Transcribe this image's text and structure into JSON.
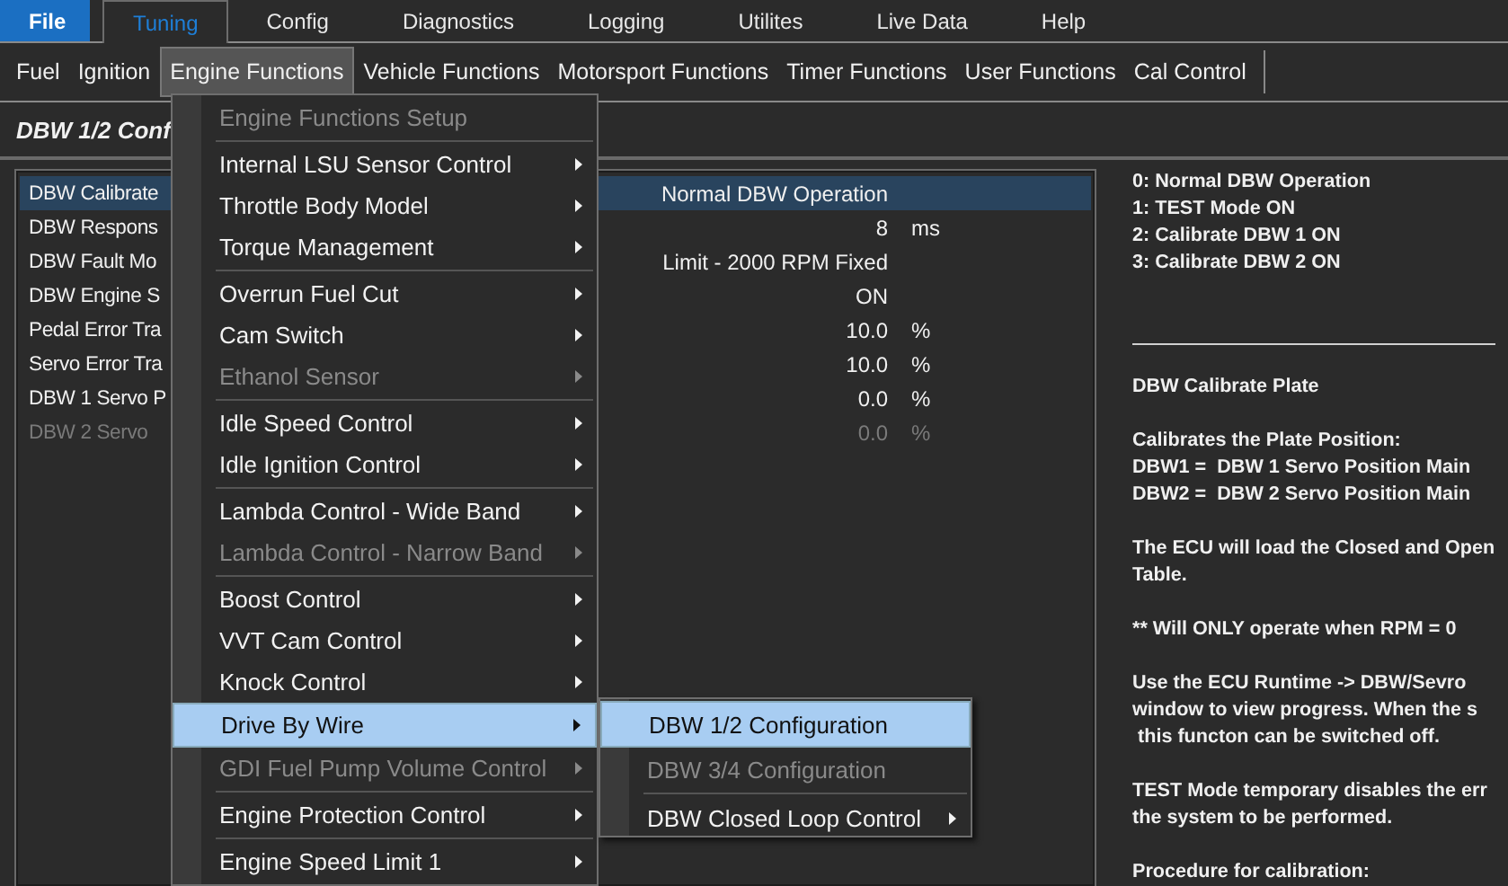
{
  "menubar": [
    {
      "label": "File",
      "kind": "file",
      "selected": false
    },
    {
      "label": "Tuning",
      "kind": "tab",
      "selected": true
    },
    {
      "label": "Config",
      "kind": "tab",
      "selected": false
    },
    {
      "label": "Diagnostics",
      "kind": "tab",
      "selected": false
    },
    {
      "label": "Logging",
      "kind": "tab",
      "selected": false
    },
    {
      "label": "Utilites",
      "kind": "tab",
      "selected": false
    },
    {
      "label": "Live Data",
      "kind": "tab",
      "selected": false
    },
    {
      "label": "Help",
      "kind": "tab",
      "selected": false
    }
  ],
  "toolbar": [
    {
      "label": "Fuel",
      "selected": false
    },
    {
      "label": "Ignition",
      "selected": false
    },
    {
      "label": "Engine Functions",
      "selected": true
    },
    {
      "label": "Vehicle Functions",
      "selected": false
    },
    {
      "label": "Motorsport Functions",
      "selected": false
    },
    {
      "label": "Timer Functions",
      "selected": false
    },
    {
      "label": "User Functions",
      "selected": false
    },
    {
      "label": "Cal Control",
      "selected": false
    }
  ],
  "page_title": "DBW 1/2 Conf",
  "settings": [
    {
      "name": "DBW Calibrate",
      "value": "Normal DBW Operation",
      "selected": true,
      "disabled": false
    },
    {
      "name": "DBW Respons",
      "value": "8",
      "unit": "ms",
      "selected": false,
      "disabled": false
    },
    {
      "name": "DBW Fault Mo",
      "value": "Limit - 2000 RPM Fixed",
      "selected": false,
      "disabled": false
    },
    {
      "name": "DBW Engine S",
      "value": "ON",
      "selected": false,
      "disabled": false
    },
    {
      "name": "Pedal Error Tra",
      "value": "10.0",
      "unit": "%",
      "selected": false,
      "disabled": false
    },
    {
      "name": "Servo Error Tra",
      "value": "10.0",
      "unit": "%",
      "selected": false,
      "disabled": false
    },
    {
      "name": "DBW 1 Servo P",
      "value": "0.0",
      "unit": "%",
      "selected": false,
      "disabled": false
    },
    {
      "name": "DBW 2 Servo",
      "value": "0.0",
      "unit": "%",
      "selected": false,
      "disabled": true
    }
  ],
  "help": {
    "options": [
      "0: Normal DBW Operation",
      "1: TEST Mode ON",
      "2: Calibrate DBW 1 ON",
      "3: Calibrate DBW 2 ON"
    ],
    "paragraphs": [
      [
        "DBW Calibrate Plate"
      ],
      [
        "Calibrates the Plate Position:",
        "DBW1 =  DBW 1 Servo Position Main",
        "DBW2 =  DBW 2 Servo Position Main"
      ],
      [
        "The ECU will load the Closed and Open",
        "Table."
      ],
      [
        "** Will ONLY operate when RPM = 0"
      ],
      [
        "Use the ECU Runtime -> DBW/Sevro",
        "window to view progress. When the s",
        " this functon can be switched off."
      ],
      [
        "TEST Mode temporary disables the err",
        "the system to be performed."
      ],
      [
        "Procedure for calibration:"
      ]
    ]
  },
  "menu": [
    [
      {
        "label": "Engine Functions Setup",
        "disabled": true,
        "submenu": false,
        "selected": false
      }
    ],
    [
      {
        "label": "Internal LSU Sensor Control",
        "disabled": false,
        "submenu": true,
        "selected": false
      },
      {
        "label": "Throttle Body Model",
        "disabled": false,
        "submenu": true,
        "selected": false
      },
      {
        "label": "Torque Management",
        "disabled": false,
        "submenu": true,
        "selected": false
      }
    ],
    [
      {
        "label": "Overrun Fuel Cut",
        "disabled": false,
        "submenu": true,
        "selected": false
      },
      {
        "label": "Cam Switch",
        "disabled": false,
        "submenu": true,
        "selected": false
      },
      {
        "label": "Ethanol Sensor",
        "disabled": true,
        "submenu": true,
        "selected": false
      }
    ],
    [
      {
        "label": "Idle Speed Control",
        "disabled": false,
        "submenu": true,
        "selected": false
      },
      {
        "label": "Idle Ignition Control",
        "disabled": false,
        "submenu": true,
        "selected": false
      }
    ],
    [
      {
        "label": "Lambda Control - Wide Band",
        "disabled": false,
        "submenu": true,
        "selected": false
      },
      {
        "label": "Lambda Control - Narrow Band",
        "disabled": true,
        "submenu": true,
        "selected": false
      }
    ],
    [
      {
        "label": "Boost Control",
        "disabled": false,
        "submenu": true,
        "selected": false
      },
      {
        "label": "VVT Cam Control",
        "disabled": false,
        "submenu": true,
        "selected": false
      },
      {
        "label": "Knock Control",
        "disabled": false,
        "submenu": true,
        "selected": false
      },
      {
        "label": "Drive By Wire",
        "disabled": false,
        "submenu": true,
        "selected": true
      },
      {
        "label": "GDI Fuel Pump Volume Control",
        "disabled": true,
        "submenu": true,
        "selected": false
      }
    ],
    [
      {
        "label": "Engine Protection Control",
        "disabled": false,
        "submenu": true,
        "selected": false
      }
    ],
    [
      {
        "label": "Engine Speed Limit 1",
        "disabled": false,
        "submenu": true,
        "selected": false
      }
    ]
  ],
  "submenu": [
    [
      {
        "label": "DBW 1/2 Configuration",
        "disabled": false,
        "submenu": false,
        "selected": true
      },
      {
        "label": "DBW 3/4 Configuration",
        "disabled": true,
        "submenu": false,
        "selected": false
      }
    ],
    [
      {
        "label": "DBW Closed Loop Control",
        "disabled": false,
        "submenu": true,
        "selected": false
      }
    ]
  ]
}
